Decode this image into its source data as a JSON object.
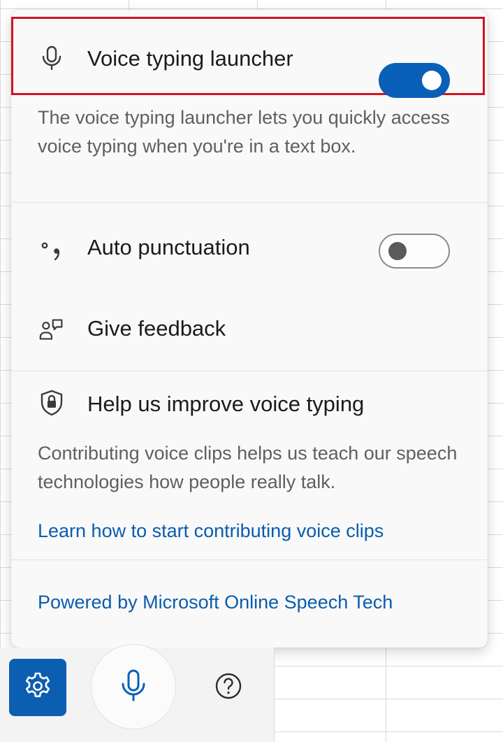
{
  "panel": {
    "launcher": {
      "icon": "microphone-icon",
      "label": "Voice typing launcher",
      "enabled": true
    },
    "launcher_desc": "The voice typing launcher lets you quickly access voice typing when you're in a text box.",
    "auto_punctuation": {
      "icon": "punctuation-icon",
      "label": "Auto punctuation",
      "enabled": false
    },
    "feedback": {
      "icon": "feedback-icon",
      "label": "Give feedback"
    },
    "improve": {
      "icon": "shield-lock-icon",
      "label": "Help us improve voice typing",
      "desc": "Contributing voice clips helps us teach our speech technologies how people really talk.",
      "link": "Learn how to start contributing voice clips"
    },
    "powered_by": "Powered by Microsoft Online Speech Tech"
  },
  "toolbar": {
    "settings_icon": "gear-icon",
    "mic_icon": "microphone-icon",
    "help_icon": "question-mark-icon"
  },
  "colors": {
    "accent": "#0a5fb8",
    "link": "#0b5cad",
    "highlight": "#d3131e"
  }
}
